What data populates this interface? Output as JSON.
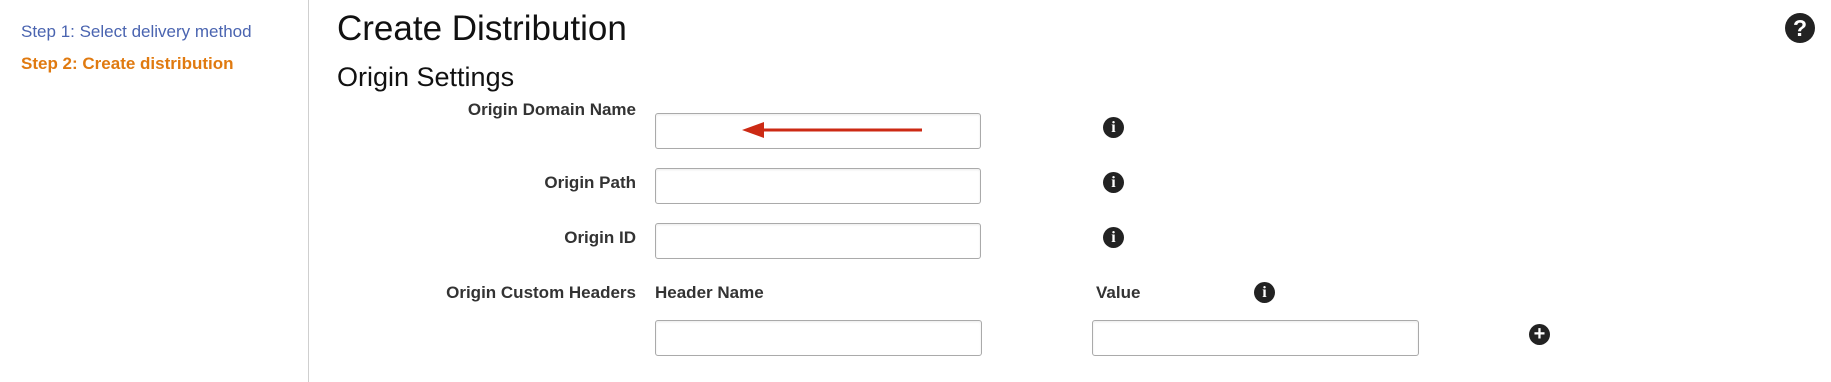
{
  "steps": {
    "step1": "Step 1: Select delivery method",
    "step2": "Step 2: Create distribution"
  },
  "page_title": "Create Distribution",
  "section_title": "Origin Settings",
  "help_icon": {
    "icon": "question-circle-icon",
    "glyph": "?"
  },
  "fields": {
    "origin_domain_name": {
      "label": "Origin Domain Name",
      "value": "",
      "placeholder": ""
    },
    "origin_path": {
      "label": "Origin Path",
      "value": "",
      "placeholder": ""
    },
    "origin_id": {
      "label": "Origin ID",
      "value": "",
      "placeholder": ""
    }
  },
  "custom_headers": {
    "label": "Origin Custom Headers",
    "header_name_col": "Header Name",
    "value_col": "Value",
    "header_name_value": "",
    "value_value": ""
  },
  "icons": {
    "info": "info-icon",
    "info_glyph": "i",
    "add": "plus-circle-icon",
    "add_glyph": "+"
  },
  "colors": {
    "step_link": "#4a64b0",
    "step_active": "#e07a10",
    "annotation_arrow": "#cc2a14"
  }
}
